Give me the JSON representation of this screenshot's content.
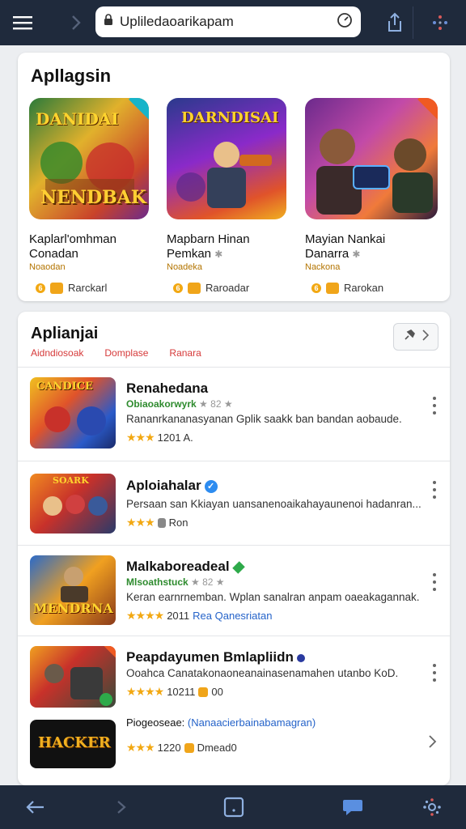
{
  "browser": {
    "url_text": "Upliledaoarikapam",
    "menu_icon": "hamburger-icon",
    "forward_icon": "chevron-right-icon",
    "share_icon": "share-icon",
    "more_icon": "dots-grid-icon"
  },
  "featured": {
    "title": "Apllagsin",
    "items": [
      {
        "art_title": "DANIDAI",
        "art_caption": "NENDBAK",
        "name_line1": "Kaplarl'omhman",
        "name_line2": "Conadan",
        "developer": "Noaodan",
        "coin": "6",
        "price_label": "Rarckarl",
        "badge": "corner-teal"
      },
      {
        "art_title": "DARNDISAI",
        "name_line1": "Mapbarn Hinan",
        "name_line2": "Pemkan",
        "developer": "Noadeka",
        "coin": "6",
        "price_label": "Raroadar",
        "badge": "none"
      },
      {
        "name_line1": "Mayian Nankai",
        "name_line2": "Danarra",
        "developer": "Nackona",
        "coin": "6",
        "price_label": "Rarokan",
        "badge": "corner-red"
      }
    ]
  },
  "list": {
    "title": "Aplianjai",
    "subtabs": [
      "Aidndiosoak",
      "Domplase",
      "Ranara"
    ],
    "rows": [
      {
        "title": "Renahedana",
        "developer": "Obiaoakorwyrk",
        "dev_extra": "★ 82 ★",
        "description": "Rananrkananasyanan Gplik saakk ban bandan aobaude.",
        "stars": "★★★",
        "rating_text": "1201 A.",
        "action": "kebab",
        "art_title": "CANDICE"
      },
      {
        "title": "Aploiahalar",
        "verified": true,
        "description": "Persaan san Kkiayan uansanenoaikahayaunenoi hadanran...",
        "stars": "★★★",
        "rating_text": "Ron",
        "action": "kebab",
        "art_title": "SOARK"
      },
      {
        "title": "Malkaboreadeal",
        "gem": true,
        "developer": "Mlsoathstuck",
        "dev_extra": "★ 82 ★",
        "description": "Keran earnrnemban. Wplan sanalran anpam oaeakagannak.",
        "stars": "★★★★",
        "rating_text": "2011",
        "rating_link": "Rea Qanesriatan",
        "action": "kebab",
        "art_title": "MENDRNA"
      },
      {
        "title": "Peapdayumen Bmlapliidn",
        "description": "Ooahca Canatakonaoneanainasenamahen utanbo KoD.",
        "stars": "★★★★",
        "rating_text": "10211",
        "rating_extra": "00",
        "action": "kebab"
      },
      {
        "title": "Piogeoseae:",
        "title_link": "(Nanaacierbainabamagran)",
        "description": "",
        "stars": "★★★",
        "rating_text": "1220",
        "rating_extra": "Dmead0",
        "action": "chevron",
        "art_title": "HACKER"
      }
    ]
  },
  "bottom": {
    "back_icon": "back-arrow-icon",
    "forward_icon": "chevron-right-icon",
    "tabs_icon": "tabs-square-icon",
    "chat_icon": "chat-bubble-icon",
    "settings_icon": "gear-icon"
  }
}
